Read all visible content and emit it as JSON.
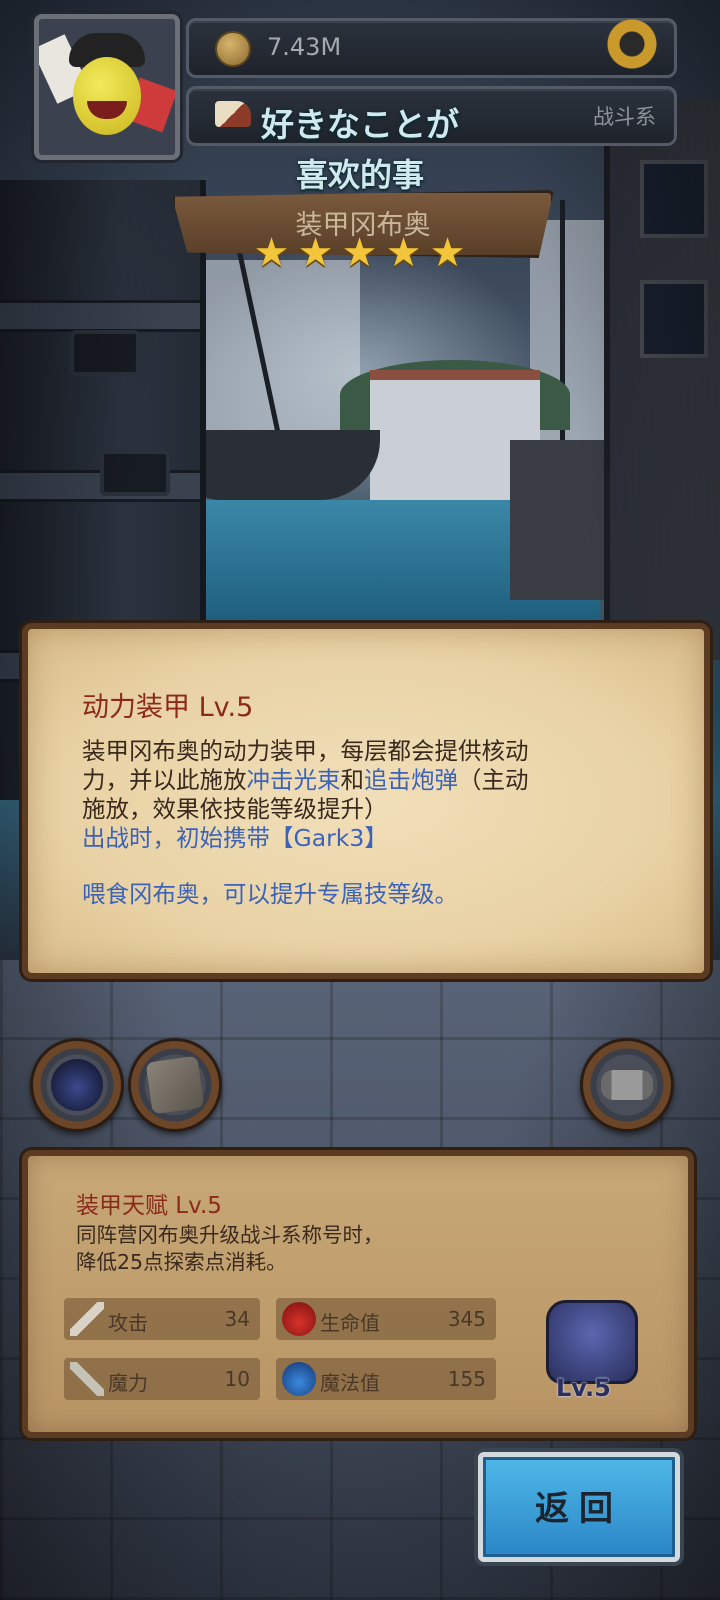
{
  "hud": {
    "coins": "7.43M",
    "class_label": "战斗系"
  },
  "overlay": {
    "jp": "好きなことが",
    "cn": "喜欢的事"
  },
  "character": {
    "name": "装甲冈布奥",
    "stars": [
      "★",
      "★",
      "★",
      "★",
      "★"
    ],
    "star_count": 5
  },
  "skill": {
    "title": "动力装甲 Lv.5",
    "line1_a": "装甲冈布奥的动力装甲，每层都会提供核动",
    "line2_a": "力，并以此施放",
    "line2_b": "冲击光束",
    "line2_c": "和",
    "line2_d": "追击炮弹",
    "line2_e": "（主动",
    "line3": "施放，效果依技能等级提升）",
    "line4": "出战时，初始携带【Gark3】",
    "feed": "喂食冈布奥，可以提升专属技等级。"
  },
  "talent": {
    "title": "装甲天赋 Lv.5",
    "desc1": "同阵营冈布奥升级战斗系称号时，",
    "desc2": "降低25点探索点消耗。",
    "stats": {
      "attack": {
        "label": "攻击",
        "value": "34"
      },
      "hp": {
        "label": "生命值",
        "value": "345"
      },
      "magic": {
        "label": "魔力",
        "value": "10"
      },
      "mp": {
        "label": "魔法值",
        "value": "155"
      }
    },
    "equip_level": "Lv.5"
  },
  "buttons": {
    "back": "返回"
  },
  "colors": {
    "skill_title": "#8b2a1b",
    "highlight_blue": "#3c63b8",
    "star": "#f2c53a",
    "back_button": "#2a86c6"
  }
}
